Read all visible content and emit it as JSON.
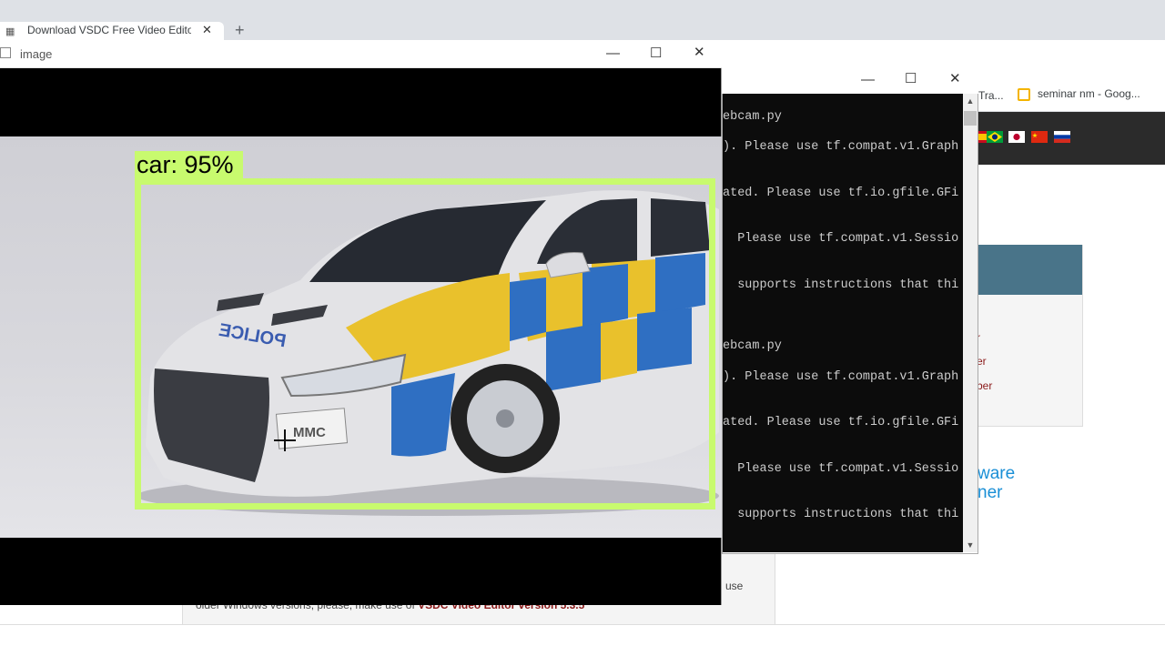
{
  "browser": {
    "tab_title": "Download VSDC Free Video Edito",
    "tab_close": "✕",
    "new_tab": "+",
    "bookmarks": [
      {
        "label": "Tra..."
      },
      {
        "label": "seminar nm - Goog..."
      }
    ]
  },
  "site": {
    "panel_links": [
      "r",
      "er",
      "ber"
    ],
    "software_lines": [
      "ware",
      "ner"
    ],
    "old_versions_text": "older Windows versions, please, make use of",
    "old_versions_link": "VSDC Video Editor version 5.3.5",
    "use_text": "use"
  },
  "console": {
    "minimize": "—",
    "maximize": "☐",
    "close": "✕",
    "lines": [
      "ebcam.py",
      "). Please use tf.compat.v1.Graph",
      "ated. Please use tf.io.gfile.GFi",
      "  Please use tf.compat.v1.Sessio",
      "  supports instructions that thi",
      "ebcam.py",
      "). Please use tf.compat.v1.Graph",
      "ated. Please use tf.io.gfile.GFi",
      "  Please use tf.compat.v1.Sessio",
      "  supports instructions that thi"
    ]
  },
  "image_window": {
    "title": "image",
    "minimize": "—",
    "maximize": "☐",
    "close": "✕",
    "detection": {
      "label": "car: 95%",
      "box_color": "#c8fa6e"
    },
    "plate_text": "MMC",
    "police_text": "POLICE"
  }
}
